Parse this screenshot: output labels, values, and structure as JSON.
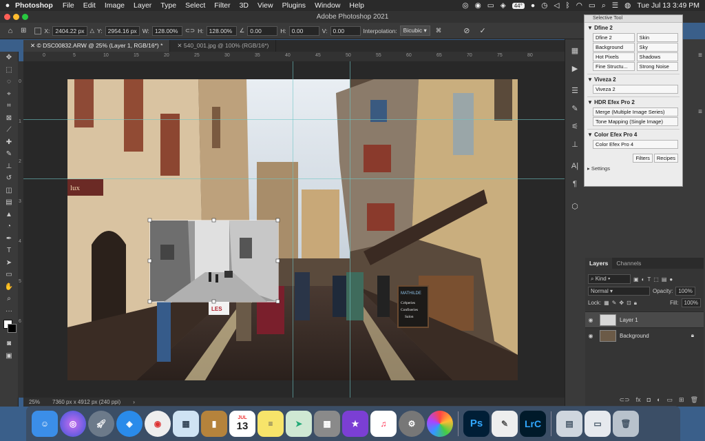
{
  "menubar": {
    "app_name": "Photoshop",
    "items": [
      "File",
      "Edit",
      "Image",
      "Layer",
      "Type",
      "Select",
      "Filter",
      "3D",
      "View",
      "Plugins",
      "Window",
      "Help"
    ],
    "battery": "44°",
    "clock": "Tue Jul 13  3:49 PM"
  },
  "window": {
    "title": "Adobe Photoshop 2021"
  },
  "options": {
    "x_label": "X:",
    "x_value": "2404.22 px",
    "y_label": "Y:",
    "y_value": "2954.16 px",
    "w_label": "W:",
    "w_value": "128.00%",
    "h_label": "H:",
    "h_value": "128.00%",
    "angle_value": "0.00",
    "hskew_label": "H:",
    "hskew_value": "0.00",
    "vskew_label": "V:",
    "vskew_value": "0.00",
    "interp_label": "Interpolation:",
    "interp_value": "Bicubic"
  },
  "tabs": [
    {
      "label": "© DSC00832.ARW @ 25% (Layer 1, RGB/16*) *",
      "active": true
    },
    {
      "label": "540_001.jpg @ 100% (RGB/16*)",
      "active": false
    }
  ],
  "ruler_top": [
    "0",
    "5",
    "10",
    "15",
    "20",
    "25",
    "30",
    "35",
    "40",
    "45",
    "50",
    "55",
    "60",
    "65",
    "70",
    "75",
    "80"
  ],
  "ruler_left": [
    "0",
    "1",
    "2",
    "3",
    "4",
    "5",
    "6"
  ],
  "status": {
    "zoom": "25%",
    "doc_info": "7360 px x 4912 px (240 ppi)"
  },
  "photo": {
    "sign_left": "lux",
    "sign_board_1": "MATHILDE",
    "sign_board_2": "Crêperies",
    "sign_board_3": "Confiseries",
    "sign_board_4": "Salon",
    "sign_less": "LES"
  },
  "selective_tool": {
    "title": "Selective Tool",
    "sections": [
      {
        "name": "Dfine 2",
        "buttons": [
          "Dfine 2",
          "Skin",
          "Background",
          "Sky",
          "Hot Pixels",
          "Shadows",
          "Fine Structu...",
          "Strong Noise"
        ]
      },
      {
        "name": "Viveza 2",
        "buttons": [
          "Viveza 2"
        ]
      },
      {
        "name": "HDR Efex Pro 2",
        "buttons": [
          "Merge (Multiple Image Series)",
          "Tone Mapping (Single Image)"
        ]
      },
      {
        "name": "Color Efex Pro 4",
        "buttons": [
          "Color Efex Pro 4"
        ]
      }
    ],
    "tab_filters": "Filters",
    "tab_recipes": "Recipes",
    "settings": "Settings"
  },
  "layers_panel": {
    "tab_layers": "Layers",
    "tab_channels": "Channels",
    "search_placeholder": "Kind",
    "blend_mode": "Normal",
    "opacity_label": "Opacity:",
    "opacity_value": "100%",
    "lock_label": "Lock:",
    "fill_label": "Fill:",
    "fill_value": "100%",
    "layers": [
      {
        "name": "Layer 1",
        "active": true
      },
      {
        "name": "Background",
        "active": false
      }
    ]
  },
  "dock": {
    "ps_label": "Ps",
    "lrc_label": "LrC",
    "calendar_month": "JUL",
    "calendar_day": "13"
  },
  "colors": {
    "panel_bg": "#3a3a3a",
    "canvas_bg": "#282828",
    "accent": "#31a8ff"
  }
}
